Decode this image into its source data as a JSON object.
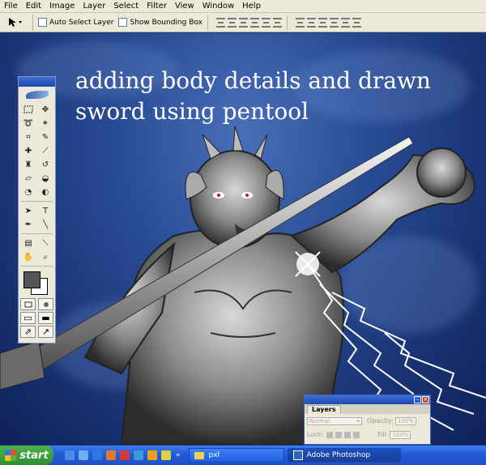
{
  "menu": [
    "File",
    "Edit",
    "Image",
    "Layer",
    "Select",
    "Filter",
    "View",
    "Window",
    "Help"
  ],
  "options_bar": {
    "tool_icon": "move-tool-icon",
    "auto_select_label": "Auto Select Layer",
    "show_bounding_label": "Show Bounding Box"
  },
  "canvas": {
    "caption_line1": "adding body details and drawn",
    "caption_line2": "sword using pentool"
  },
  "toolbox": {
    "tools": [
      "marquee-icon",
      "move-icon",
      "lasso-icon",
      "magic-wand-icon",
      "crop-icon",
      "slice-icon",
      "healing-brush-icon",
      "brush-icon",
      "stamp-icon",
      "history-brush-icon",
      "eraser-icon",
      "paint-bucket-icon",
      "blur-icon",
      "dodge-icon",
      "path-select-icon",
      "type-icon",
      "pen-icon",
      "line-icon",
      "notes-icon",
      "eyedropper-icon",
      "hand-icon",
      "zoom-icon"
    ],
    "type_glyph": "T",
    "foreground_color": "#555555",
    "background_color": "#ffffff"
  },
  "layers_palette": {
    "tab": "Layers",
    "blend_mode": "Normal",
    "opacity_label": "Opacity:",
    "opacity_value": "100%",
    "lock_label": "Lock:",
    "fill_label": "Fill:",
    "fill_value": "100%"
  },
  "taskbar": {
    "start_label": "start",
    "expand_glyph": "»",
    "task1": "pxl",
    "task2": "Adobe Photoshop"
  }
}
